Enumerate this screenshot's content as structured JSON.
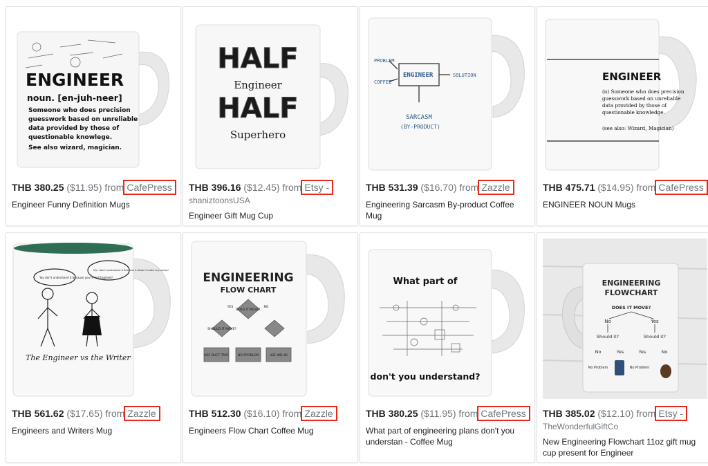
{
  "accent_red": "#e5281a",
  "products": [
    {
      "price": "THB 380.25",
      "usd": "($11.95)",
      "from": "from",
      "store": "CafePress",
      "seller": "",
      "title": "Engineer Funny Definition Mugs",
      "image": {
        "lines": [
          "ENGINEER",
          "noun. [en-juh-neer]",
          "Someone who does precision",
          "guesswork based on unreliable",
          "data provided by those of",
          "questionable knowlege.",
          "See also wizard, magician."
        ]
      }
    },
    {
      "price": "THB 396.16",
      "usd": "($12.45)",
      "from": "from",
      "store": "Etsy -",
      "seller": "shaniztoonsUSA",
      "title": "Engineer Gift Mug Cup",
      "image": {
        "lines": [
          "HALF",
          "Engineer",
          "HALF",
          "Superhero"
        ]
      }
    },
    {
      "price": "THB 531.39",
      "usd": "($16.70)",
      "from": "from",
      "store": "Zazzle",
      "seller": "",
      "title": "Engineering Sarcasm By-product Coffee Mug",
      "image": {
        "lines": [
          "PROBLEM",
          "COFFEE",
          "ENGINEER",
          "SOLUTION",
          "SARCASM",
          "(BY-PRODUCT)"
        ]
      }
    },
    {
      "price": "THB 475.71",
      "usd": "($14.95)",
      "from": "from",
      "store": "CafePress",
      "seller": "",
      "title": "ENGINEER NOUN Mugs",
      "image": {
        "lines": [
          "ENGINEER",
          "(n) Someone who does precision",
          "guesswork based on unreliable",
          "data provided by those of",
          "questionable knowledge.",
          "(see also: Wizard, Magician)"
        ]
      }
    },
    {
      "price": "THB 561.62",
      "usd": "($17.65)",
      "from": "from",
      "store": "Zazzle",
      "seller": "",
      "title": "Engineers and Writers Mug",
      "image": {
        "lines": [
          "You don't understand it because you're not Engineer!",
          "My I don't understand it because it doesn't make any sense!",
          "The Engineer vs the Writer"
        ]
      }
    },
    {
      "price": "THB 512.30",
      "usd": "($16.10)",
      "from": "from",
      "store": "Zazzle",
      "seller": "",
      "title": "Engineers Flow Chart Coffee Mug",
      "image": {
        "lines": [
          "ENGINEERING",
          "FLOW CHART",
          "DOES IT MOVE?",
          "YES",
          "NO",
          "SHOULD IT MOVE?",
          "NO PROBLEM",
          "USE DUCT TAPE",
          "USE WD-40"
        ]
      }
    },
    {
      "price": "THB 380.25",
      "usd": "($11.95)",
      "from": "from",
      "store": "CafePress",
      "seller": "",
      "title": "What part of engineering plans don't you understan - Coffee Mug",
      "image": {
        "lines": [
          "What part of",
          "don't you understand?"
        ]
      }
    },
    {
      "price": "THB 385.02",
      "usd": "($12.10)",
      "from": "from",
      "store": "Etsy -",
      "seller": "TheWonderfulGiftCo",
      "title": "New Engineering Flowchart 11oz gift mug cup present for Engineer",
      "image": {
        "lines": [
          "ENGINEERING",
          "FLOWCHART",
          "DOES IT MOVE?",
          "No",
          "Yes",
          "Should it?",
          "Should it?",
          "Yes",
          "No",
          "Yes",
          "No",
          "No Problem",
          "No Problem"
        ]
      }
    }
  ]
}
